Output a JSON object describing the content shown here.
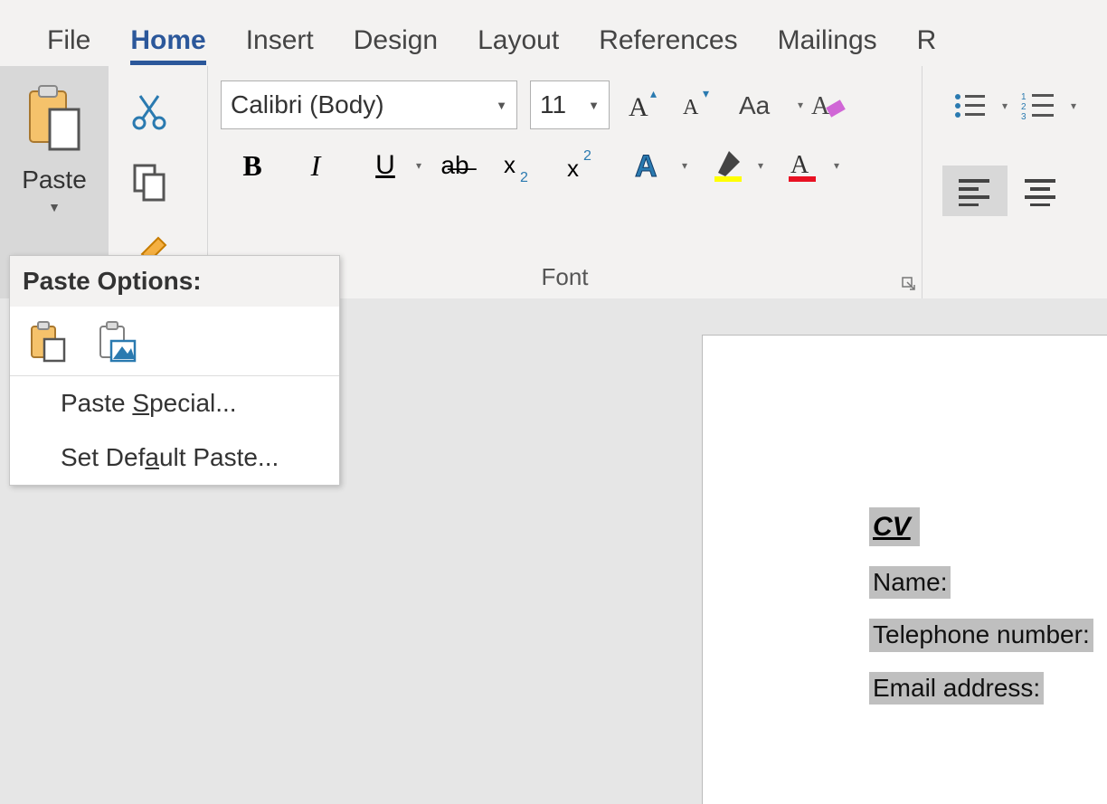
{
  "tabs": {
    "file": "File",
    "home": "Home",
    "insert": "Insert",
    "design": "Design",
    "layout": "Layout",
    "references": "References",
    "mailings": "Mailings",
    "review_partial": "R"
  },
  "clipboard": {
    "paste_label": "Paste"
  },
  "font": {
    "name": "Calibri (Body)",
    "size": "11",
    "group_label": "Font"
  },
  "paste_menu": {
    "title": "Paste Options:",
    "paste_special_pre": "Paste ",
    "paste_special_u": "S",
    "paste_special_post": "pecial...",
    "set_default_pre": "Set Def",
    "set_default_u": "a",
    "set_default_post": "ult Paste..."
  },
  "document": {
    "cv": "CV",
    "name": "Name:",
    "tel": "Telephone number:",
    "email": "Email address:"
  }
}
